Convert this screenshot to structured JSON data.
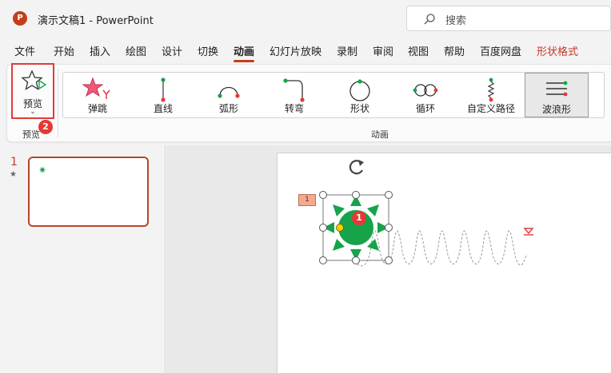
{
  "titlebar": {
    "logo": "P",
    "document": "演示文稿1  -  PowerPoint"
  },
  "search": {
    "placeholder": "搜索",
    "icon": "search-icon"
  },
  "tabs": {
    "file": "文件",
    "home": "开始",
    "insert": "插入",
    "draw": "绘图",
    "design": "设计",
    "transitions": "切换",
    "animations": "动画",
    "slideshow": "幻灯片放映",
    "record": "录制",
    "review": "审阅",
    "view": "视图",
    "help": "帮助",
    "baidu": "百度网盘",
    "shape_format": "形状格式",
    "active": "动画"
  },
  "ribbon": {
    "preview": {
      "label": "预览",
      "group_label": "预览",
      "chevron": "⌄",
      "step_badge": "2",
      "icon": "star-preview-icon"
    },
    "animation_group_label": "动画",
    "effects": {
      "bounce": "弹跳",
      "line": "直线",
      "arc": "弧形",
      "turn": "转弯",
      "shape": "形状",
      "loop": "循环",
      "custom_path": "自定义路径",
      "wave": "波浪形"
    },
    "selected_effect": "波浪形"
  },
  "slides_pane": {
    "slide_number": "1",
    "star": "★"
  },
  "canvas": {
    "animation_tag": "1",
    "shape_badge": "1"
  },
  "colors": {
    "accent": "#c43e1c",
    "badge": "#e53935",
    "shape_green": "#16a34a",
    "highlight_red": "#e03b3b",
    "contextual_tab": "#c0392b"
  }
}
